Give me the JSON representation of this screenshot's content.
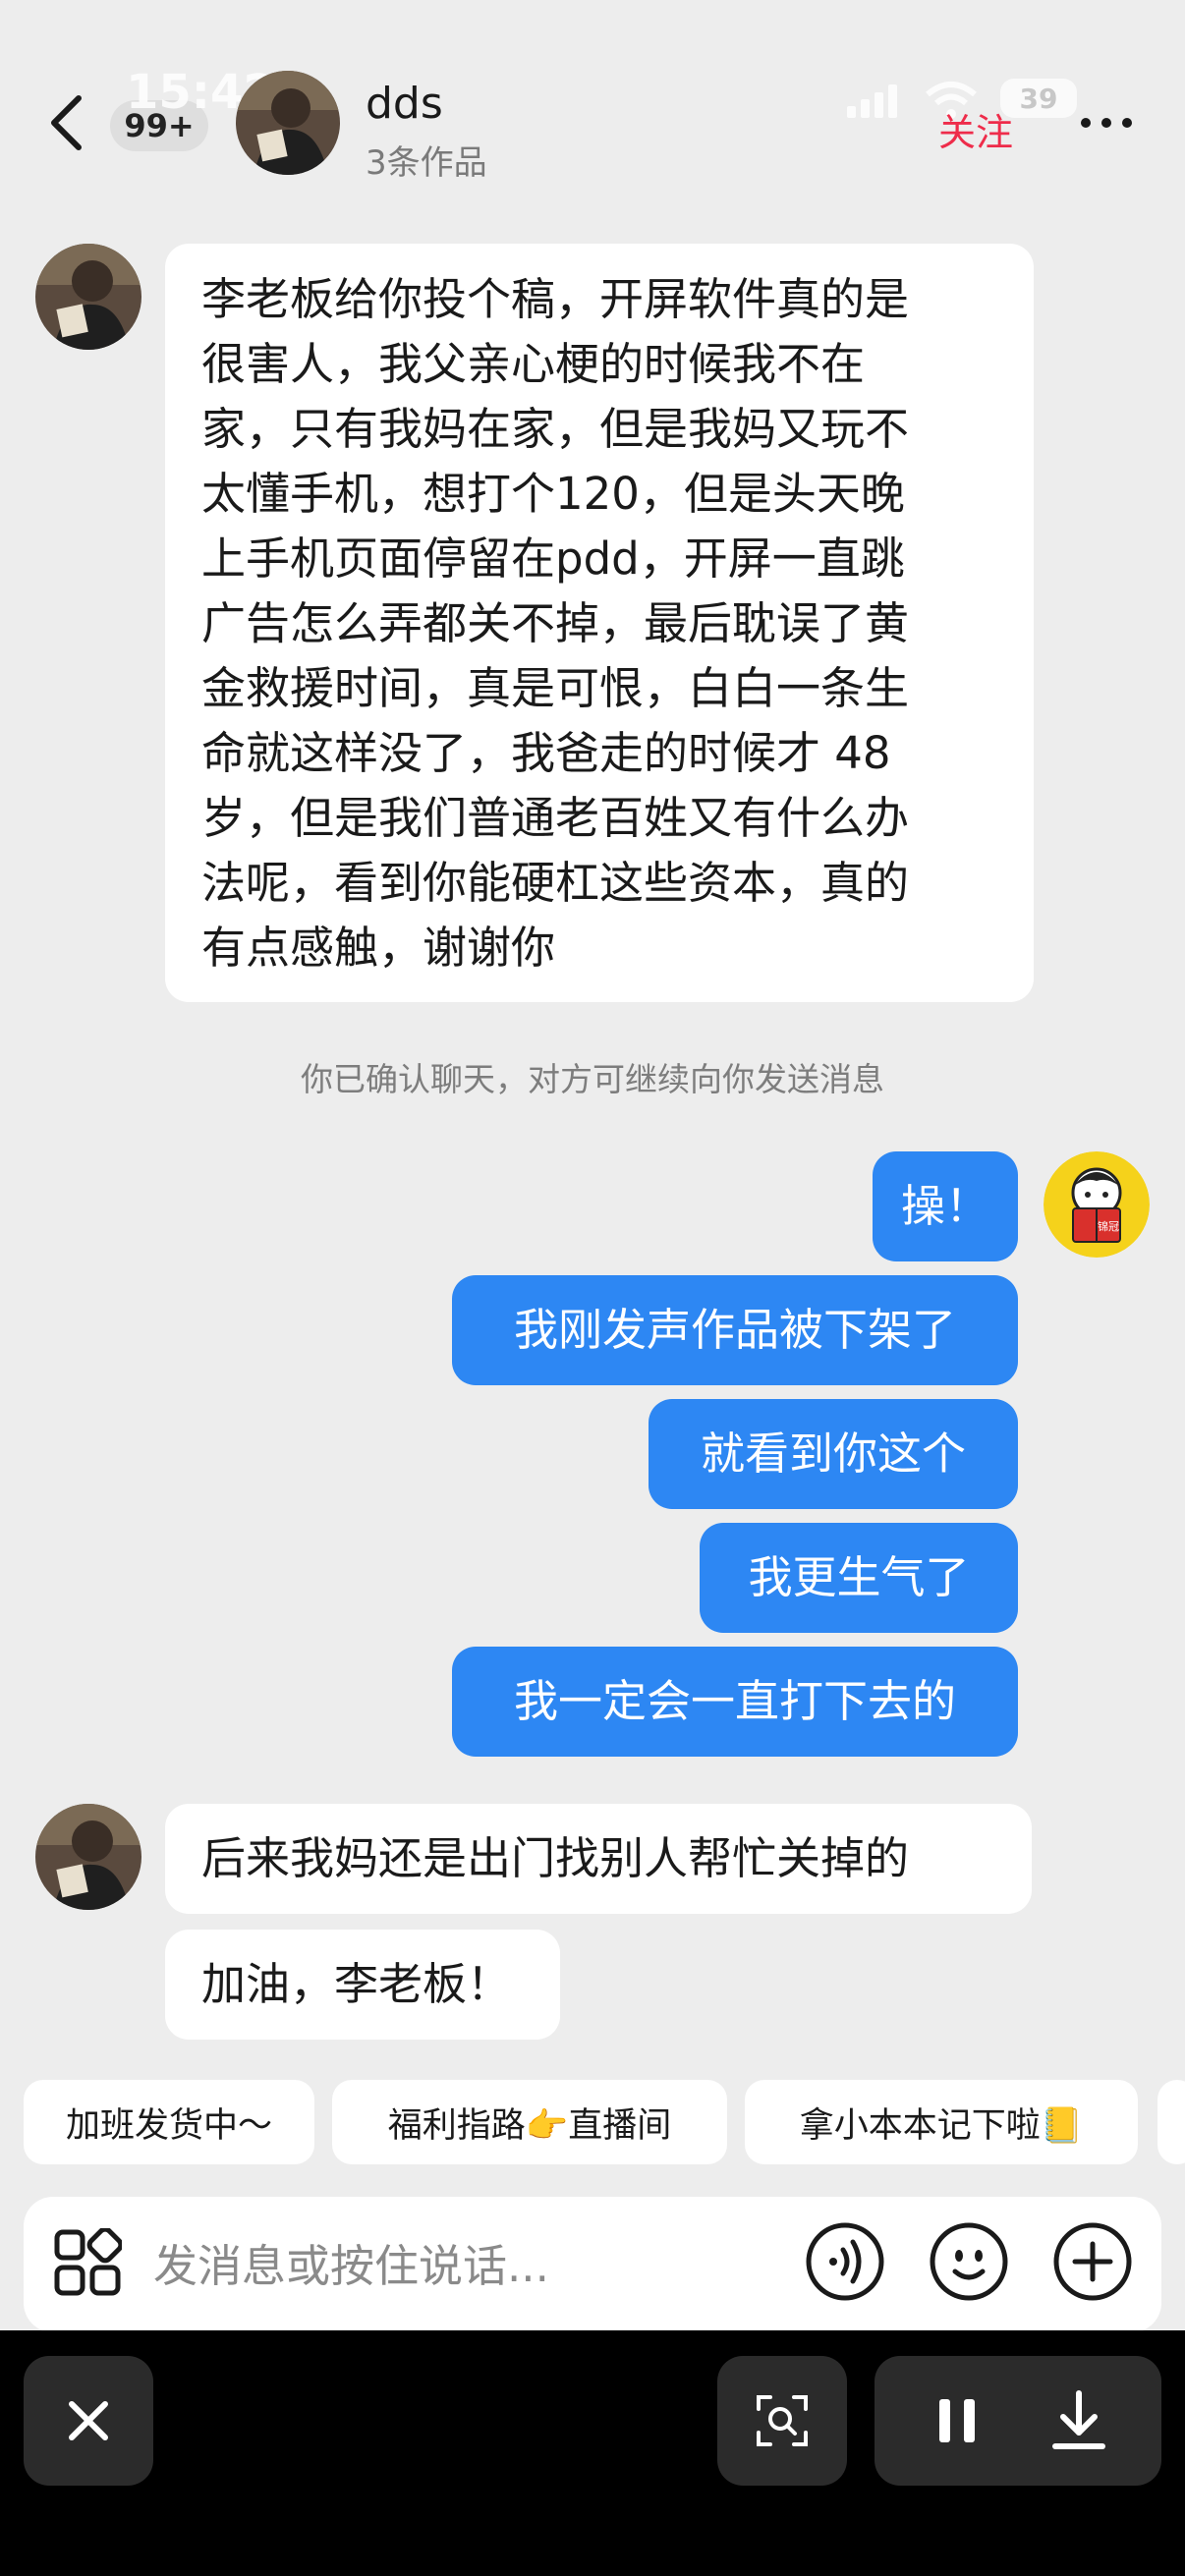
{
  "status_bar": {
    "time": "15:42",
    "battery": "39"
  },
  "header": {
    "unread_badge": "99+",
    "contact_name": "dds",
    "contact_subtitle": "3条作品",
    "follow_label": "关注"
  },
  "messages": [
    {
      "id": "m1",
      "side": "in",
      "text_lines": [
        "李老板给你投个稿，开屏软件真的是",
        "很害人，我父亲心梗的时候我不在",
        "家，只有我妈在家，但是我妈又玩不",
        "太懂手机，想打个120，但是头天晚",
        "上手机页面停留在pdd，开屏一直跳",
        "广告怎么弄都关不掉，最后耽误了黄",
        "金救援时间，真是可恨，白白一条生",
        "命就这样没了，我爸走的时候才 48",
        "岁，但是我们普通老百姓又有什么办",
        "法呢，看到你能硬杠这些资本，真的",
        "有点感触，谢谢你"
      ]
    },
    {
      "id": "m2",
      "side": "out",
      "text": "操！"
    },
    {
      "id": "m3",
      "side": "out",
      "text": "我刚发声作品被下架了"
    },
    {
      "id": "m4",
      "side": "out",
      "text": "就看到你这个"
    },
    {
      "id": "m5",
      "side": "out",
      "text": "我更生气了"
    },
    {
      "id": "m6",
      "side": "out",
      "text": "我一定会一直打下去的"
    },
    {
      "id": "m7",
      "side": "in",
      "text": "后来我妈还是出门找别人帮忙关掉的"
    },
    {
      "id": "m8",
      "side": "in",
      "text": "加油，李老板！"
    }
  ],
  "system_note": "你已确认聊天，对方可继续向你发送消息",
  "quick_replies": [
    "加班发货中～",
    "福利指路👉直播间",
    "拿小本本记下啦📒"
  ],
  "composer": {
    "placeholder": "发消息或按住说话..."
  },
  "my_avatar_badge": "锦冠",
  "colors": {
    "accent_blue": "#2d87f3",
    "follow_red": "#ee2c4a",
    "background": "#ededed"
  }
}
